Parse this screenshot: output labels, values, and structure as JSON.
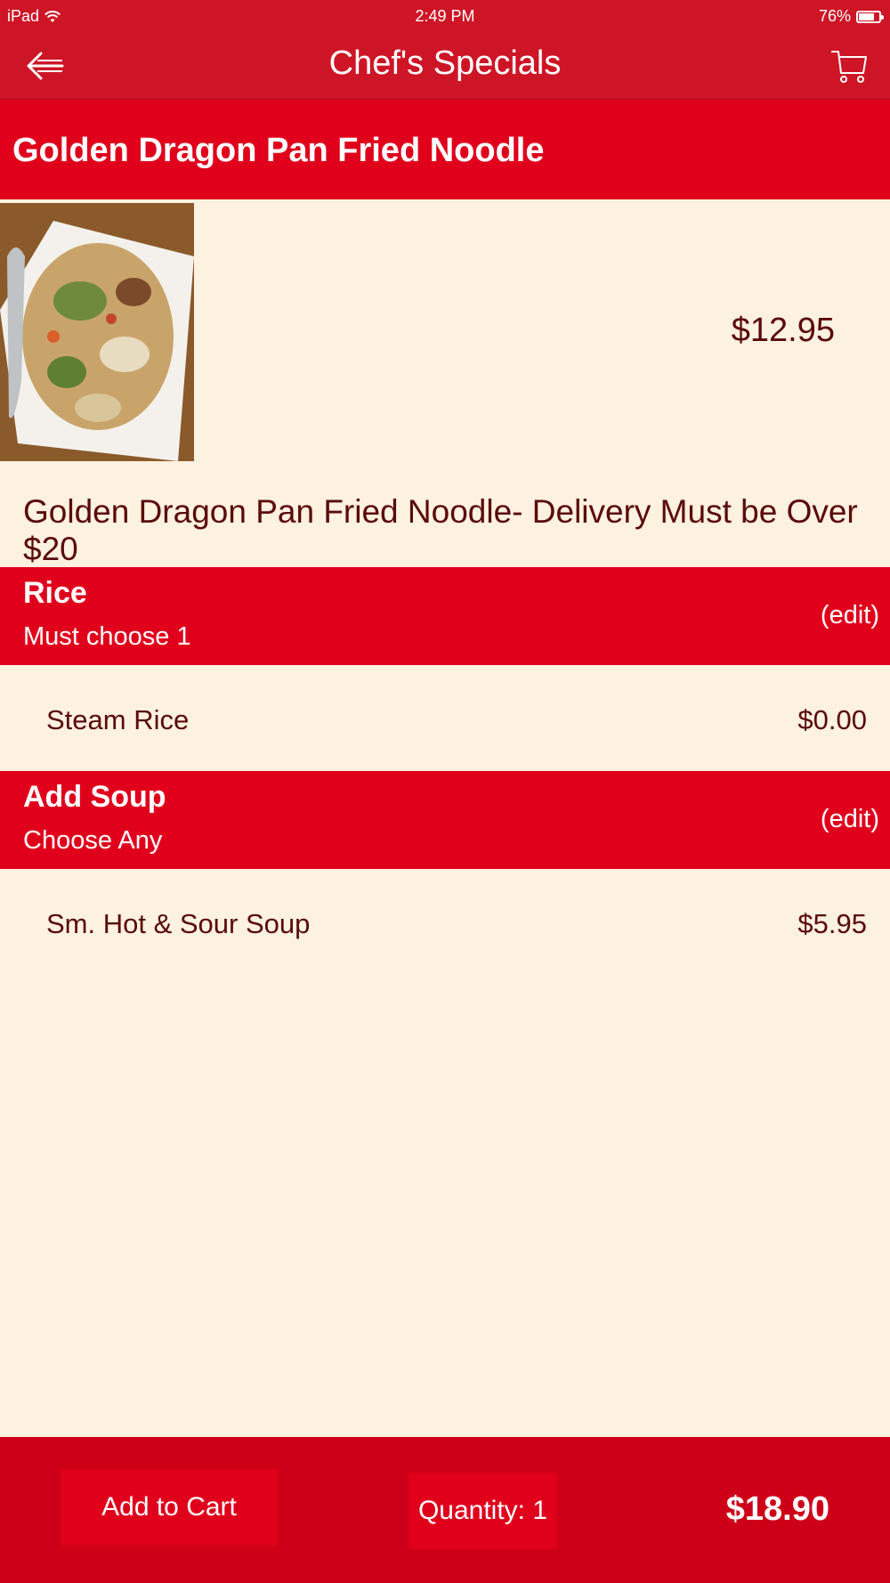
{
  "status_bar": {
    "device": "iPad",
    "time": "2:49 PM",
    "battery": "76%",
    "battery_level": 0.76
  },
  "nav": {
    "title": "Chef's Specials",
    "back_icon": "back-arrow-icon",
    "cart_icon": "cart-icon"
  },
  "item": {
    "name": "Golden Dragon Pan Fried Noodle",
    "price": "$12.95",
    "description": "Golden Dragon Pan Fried Noodle- Delivery Must be Over $20"
  },
  "sections": [
    {
      "title": "Rice",
      "subtitle": "Must choose 1",
      "edit_label": "(edit)",
      "option": {
        "label": "Steam Rice",
        "price": "$0.00"
      }
    },
    {
      "title": "Add Soup",
      "subtitle": "Choose Any",
      "edit_label": "(edit)",
      "option": {
        "label": "Sm. Hot & Sour Soup",
        "price": "$5.95"
      }
    }
  ],
  "footer": {
    "add_to_cart_label": "Add to Cart",
    "quantity_label": "Quantity: 1",
    "total": "$18.90"
  },
  "colors": {
    "bar": "#CE1526",
    "section": "#E0001C",
    "background": "#FDF1DF",
    "text": "#5A0A0A"
  }
}
